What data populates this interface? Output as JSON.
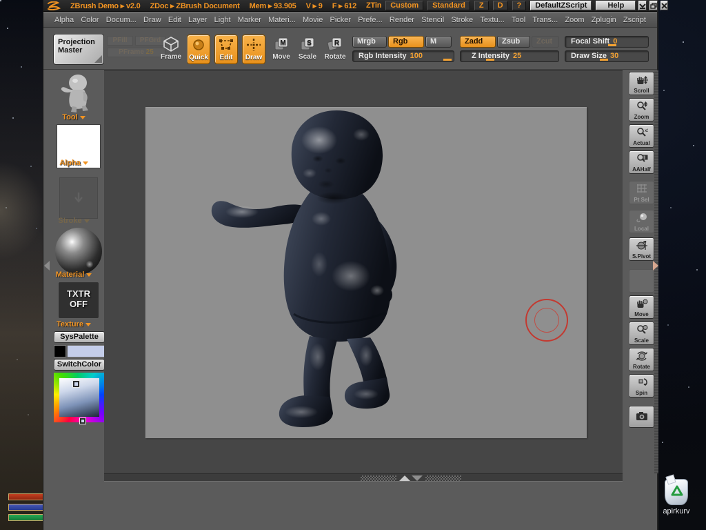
{
  "app": {
    "title_product": "ZBrush Demo ▸ v2.0",
    "title_doc": "ZDoc ▸ ZBrush Document",
    "mem": "Mem ▸ 93.905",
    "views": "V ▸ 9",
    "faces": "F ▸ 612",
    "ztin": "ZTin",
    "buttons": {
      "custom": "Custom",
      "standard": "Standard",
      "z": "Z",
      "d": "D",
      "question": "?",
      "default_zscript": "DefaultZScript",
      "help": "Help"
    }
  },
  "menus": {
    "items": [
      "Alpha",
      "Color",
      "Docum...",
      "Draw",
      "Edit",
      "Layer",
      "Light",
      "Marker",
      "Materi...",
      "Movie",
      "Picker",
      "Prefe...",
      "Render",
      "Stencil",
      "Stroke",
      "Textu...",
      "Tool",
      "Trans...",
      "Zoom",
      "Zplugin",
      "Zscript"
    ]
  },
  "shelf": {
    "projection_line1": "Projection",
    "projection_line2": "Master",
    "dim1": "PFill",
    "dim2": "PFGrd",
    "dim3_label": "PFrame",
    "dim3_value": "25",
    "frame": "Frame",
    "quick": "Quick",
    "edit": "Edit",
    "draw": "Draw",
    "move": "Move",
    "scale": "Scale",
    "rotate": "Rotate",
    "mrgb": "Mrgb",
    "rgb": "Rgb",
    "m": "M",
    "zadd": "Zadd",
    "zsub": "Zsub",
    "zcut": "Zcut",
    "sliders": {
      "rgb_intensity": {
        "label": "Rgb Intensity",
        "value": "100"
      },
      "z_intensity": {
        "label": "Z Intensity",
        "value": "25"
      },
      "focal_shift": {
        "label": "Focal Shift",
        "value": "0"
      },
      "draw_size": {
        "label": "Draw Size",
        "value": "30"
      }
    }
  },
  "left_panel": {
    "tool": "Tool",
    "alpha": "Alpha",
    "stroke": "Stroke",
    "material": "Material",
    "texture": "Texture",
    "txtr_line1": "TXTR",
    "txtr_line2": "OFF",
    "sys_palette": "SysPalette",
    "switch_color": "SwitchColor"
  },
  "right_shelf": {
    "items": [
      {
        "label": "Scroll",
        "icon": "hand-scroll-icon",
        "enabled": true
      },
      {
        "label": "Zoom",
        "icon": "magnifier-zoom-icon",
        "enabled": true
      },
      {
        "label": "Actual",
        "icon": "magnifier-1x-icon",
        "enabled": true
      },
      {
        "label": "AAHalf",
        "icon": "magnifier-half-icon",
        "enabled": true
      },
      {
        "label": "Pt Sel",
        "icon": "grid-icon",
        "enabled": false
      },
      {
        "label": "Local",
        "icon": "sphere-icon",
        "enabled": false
      },
      {
        "label": "S.Pivot",
        "icon": "pivot-icon",
        "enabled": true
      },
      {
        "label": "",
        "icon": "blank",
        "enabled": false
      },
      {
        "label": "Move",
        "icon": "hand-move-icon",
        "enabled": true
      },
      {
        "label": "Scale",
        "icon": "magnifier-scale-icon",
        "enabled": true
      },
      {
        "label": "Rotate",
        "icon": "rotate-sphere-icon",
        "enabled": true
      },
      {
        "label": "Spin",
        "icon": "spin-arrow-icon",
        "enabled": true
      },
      {
        "label": "",
        "icon": "camera-icon",
        "enabled": true
      }
    ]
  },
  "desktop": {
    "recycle_label": "apirkurv"
  },
  "colors": {
    "accent": "#F2A133",
    "canvas_inner": "#8F8F8F",
    "cursor_red": "#CC2A20",
    "main_color": "#C4CDE9",
    "secondary_color": "#000000"
  }
}
